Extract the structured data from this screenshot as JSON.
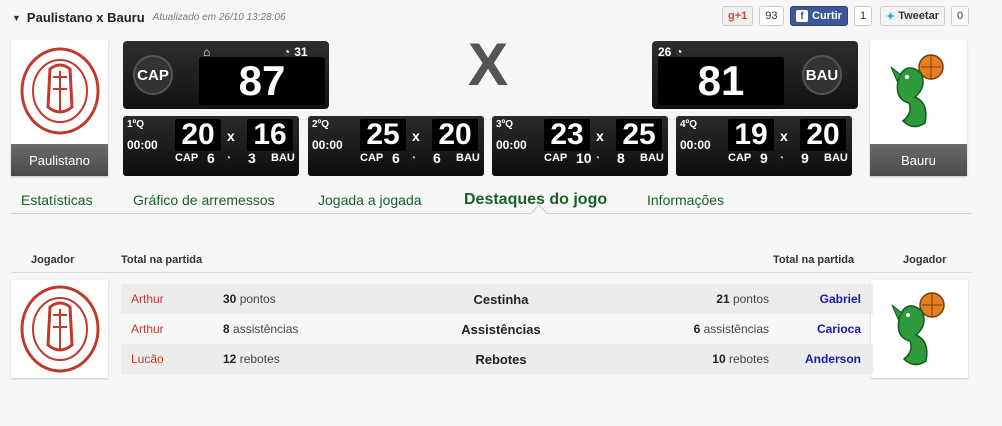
{
  "header": {
    "title": "Paulistano x Bauru",
    "updated": "Atualizado em 26/10 13:28:06"
  },
  "social": {
    "gplus_label": "+1",
    "gplus_count": "93",
    "facebook_label": "Curtir",
    "facebook_count": "1",
    "twitter_label": "Tweetar",
    "twitter_count": "0"
  },
  "center_mark": "X",
  "teams": {
    "home": {
      "name": "Paulistano",
      "abbr": "CAP",
      "score": "87",
      "fouls": "31"
    },
    "away": {
      "name": "Bauru",
      "abbr": "BAU",
      "score": "81",
      "fouls": "26"
    }
  },
  "quarters": [
    {
      "label": "1ºQ",
      "time": "00:00",
      "home_score": "20",
      "away_score": "16",
      "home_abbr": "CAP",
      "away_abbr": "BAU",
      "home_fouls": "6",
      "away_fouls": "3",
      "x": "x"
    },
    {
      "label": "2ºQ",
      "time": "00:00",
      "home_score": "25",
      "away_score": "20",
      "home_abbr": "CAP",
      "away_abbr": "BAU",
      "home_fouls": "6",
      "away_fouls": "6",
      "x": "x"
    },
    {
      "label": "3ºQ",
      "time": "00:00",
      "home_score": "23",
      "away_score": "25",
      "home_abbr": "CAP",
      "away_abbr": "BAU",
      "home_fouls": "10",
      "away_fouls": "8",
      "x": "x"
    },
    {
      "label": "4ºQ",
      "time": "00:00",
      "home_score": "19",
      "away_score": "20",
      "home_abbr": "CAP",
      "away_abbr": "BAU",
      "home_fouls": "9",
      "away_fouls": "9",
      "x": "x"
    }
  ],
  "tabs": [
    {
      "label": "Estatísticas"
    },
    {
      "label": "Gráfico de arremessos"
    },
    {
      "label": "Jogada a jogada"
    },
    {
      "label": "Destaques do jogo",
      "active": true
    },
    {
      "label": "Informações"
    }
  ],
  "highlights": {
    "headers": {
      "player_left": "Jogador",
      "total_left": "Total na partida",
      "total_right": "Total na partida",
      "player_right": "Jogador"
    },
    "rows": [
      {
        "home_player": "Arthur",
        "home_value": "30",
        "home_unit": " pontos",
        "category": "Cestinha",
        "away_value": "21",
        "away_unit": " pontos",
        "away_player": "Gabriel"
      },
      {
        "home_player": "Arthur",
        "home_value": "8",
        "home_unit": " assistências",
        "category": "Assistências",
        "away_value": "6",
        "away_unit": " assistências",
        "away_player": "Carioca"
      },
      {
        "home_player": "Lucão",
        "home_value": "12",
        "home_unit": " rebotes",
        "category": "Rebotes",
        "away_value": "10",
        "away_unit": " rebotes",
        "away_player": "Anderson"
      }
    ]
  },
  "colors": {
    "accent_green": "#1a5f2a",
    "home_player_red": "#c0392b",
    "away_player_blue": "#1a1aa6",
    "scoreboard_bg": "#111111"
  }
}
